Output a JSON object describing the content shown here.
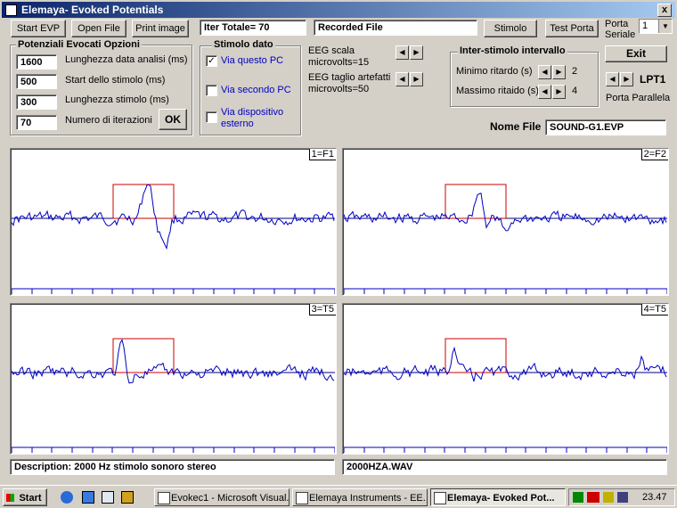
{
  "window": {
    "title": "Elemaya- Evoked Potentials",
    "close_glyph": "x"
  },
  "toolbar": {
    "start_evp": "Start EVP",
    "open_file": "Open File",
    "print_image": "Print image",
    "iter_totale": "Iter Totale= 70",
    "recorded_file": "Recorded File",
    "stimolo": "Stimolo",
    "test_porta": "Test Porta",
    "porta_seriale_label": "Porta\nSeriale",
    "porta_seriale_value": "1"
  },
  "options": {
    "title": "Potenziali Evocati Opzioni",
    "fields": [
      {
        "value": "1600",
        "label": "Lunghezza data  analisi (ms)"
      },
      {
        "value": "500",
        "label": "Start dello stimolo (ms)"
      },
      {
        "value": "300",
        "label": "Lunghezza stimolo (ms)"
      },
      {
        "value": "70",
        "label": "Numero di iterazioni"
      }
    ],
    "ok": "OK"
  },
  "stimolo_dato": {
    "title": "Stimolo dato",
    "options": [
      {
        "label": "Via questo  PC",
        "checked": true
      },
      {
        "label": "Via secondo PC",
        "checked": false
      },
      {
        "label": "Via dispositivo esterno",
        "checked": false
      }
    ]
  },
  "eeg": {
    "scala_line1": "EEG scala",
    "scala_line2": "microvolts=15",
    "taglio_line1": "EEG taglio artefatti",
    "taglio_line2": "microvolts=50"
  },
  "inter_stimolo": {
    "title": "Inter-stimolo intervallo",
    "min_label": "Minimo ritardo  (s)",
    "min_value": "2",
    "max_label": "Massimo ritaido (s)",
    "max_value": "4"
  },
  "right_panel": {
    "exit": "Exit",
    "lpt": "LPT1",
    "porta_parallela": "Porta Parallela"
  },
  "nome_file": {
    "label": "Nome File",
    "value": "SOUND-G1.EVP"
  },
  "channels": [
    {
      "label": "1=F1"
    },
    {
      "label": "2=F2"
    },
    {
      "label": "3=T5"
    },
    {
      "label": "4=T5"
    }
  ],
  "description": "Description:  2000 Hz stimolo sonoro stereo",
  "wav_file": "2000HZA.WAV",
  "taskbar": {
    "start": "Start",
    "items": [
      {
        "label": "Evokec1 - Microsoft Visual...",
        "active": false
      },
      {
        "label": "Elemaya Instruments  - EE...",
        "active": false
      },
      {
        "label": "Elemaya- Evoked Pot...",
        "active": true
      }
    ],
    "clock": "23.47"
  },
  "colors": {
    "trace": "#0000c0",
    "stim_box": "#cc0000",
    "baseline": "#000080",
    "title_bar": "#0a246a"
  }
}
